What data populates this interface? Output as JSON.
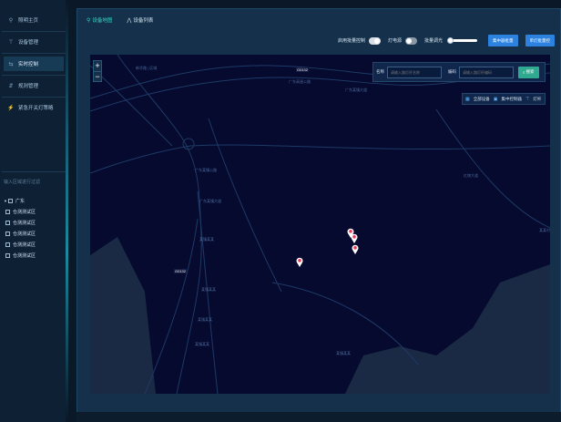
{
  "sidebar": {
    "items": [
      {
        "icon": "map-pin-icon",
        "glyph": "⚲",
        "label": "照明主页"
      },
      {
        "icon": "wrench-icon",
        "glyph": "⊤",
        "label": "设备管理"
      },
      {
        "icon": "realtime-icon",
        "glyph": "⇆",
        "label": "实时控制",
        "active": true
      },
      {
        "icon": "strategy-icon",
        "glyph": "⇵",
        "label": "规则管理"
      },
      {
        "icon": "lightning-icon",
        "glyph": "⚡",
        "label": "紧急开关灯策略"
      }
    ],
    "filter_placeholder": "输入区域进行过滤",
    "tree": {
      "root": "广东",
      "children": [
        "仓测测试区",
        "仓测测试区",
        "仓测测试区",
        "仓测测试区",
        "仓测测试区"
      ]
    }
  },
  "tabs": [
    {
      "label": "设备地图",
      "icon": "map-pin-icon",
      "glyph": "⚲",
      "active": true
    },
    {
      "label": "设备列表",
      "icon": "list-icon",
      "glyph": "⋀",
      "active": false
    }
  ],
  "toolbar": {
    "batch_control_label": "启用批量控制",
    "power_label": "灯电源",
    "brightness_label": "批量调光",
    "btn_center_label": "集中器批量",
    "btn_single_label": "单灯批量控"
  },
  "map": {
    "search": {
      "name_label": "名称",
      "name_placeholder": "请输入路灯杆名称",
      "number_label": "编码",
      "number_placeholder": "请输入路灯杆编码",
      "search_button": "搜索"
    },
    "legend": [
      {
        "icon": "grid-icon",
        "glyph": "▦",
        "label": "全部设备"
      },
      {
        "icon": "concentrator-icon",
        "glyph": "▣",
        "label": "集中控制器"
      },
      {
        "icon": "lamp-icon",
        "glyph": "⊤",
        "label": "灯杆"
      }
    ],
    "road_badges": [
      "G0132",
      "G0132"
    ],
    "labels": [
      "新华路 | 区域",
      "广东高速公路",
      "广东某镇大道",
      "广东某镇公路",
      "红旗大道",
      "广东某镇大道",
      "某镇某某",
      "某镇某某",
      "某镇某某",
      "某镇某某",
      "某镇某某",
      "某某村"
    ],
    "colors": {
      "background": "#050a2e",
      "roads": "#1e3a66",
      "land": "#1a2a44",
      "marker": "#e83a5a"
    }
  }
}
